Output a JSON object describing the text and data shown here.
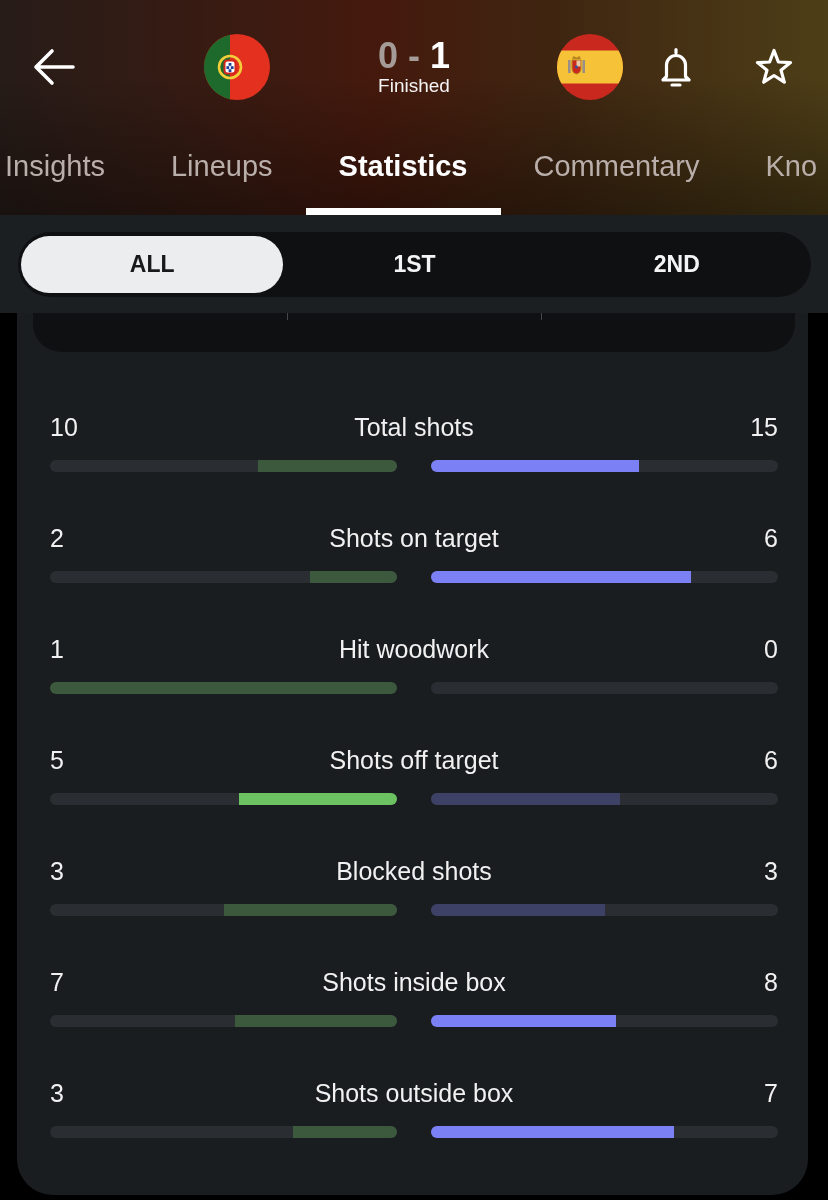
{
  "match": {
    "score": {
      "home": {
        "text": "0",
        "dimmed": true
      },
      "separator": "-",
      "away": {
        "text": "1",
        "dimmed": false
      }
    },
    "status": "Finished"
  },
  "tabs": [
    {
      "label": "Insights",
      "selected": false
    },
    {
      "label": "Lineups",
      "selected": false
    },
    {
      "label": "Statistics",
      "selected": true
    },
    {
      "label": "Commentary",
      "selected": false
    },
    {
      "label": "Kno",
      "selected": false
    }
  ],
  "periods": [
    {
      "label": "ALL",
      "selected": true
    },
    {
      "label": "1ST",
      "selected": false
    },
    {
      "label": "2ND",
      "selected": false
    }
  ],
  "stats": [
    {
      "label": "Total shots",
      "home": {
        "value": "10",
        "level": 0.4,
        "highlighted": false
      },
      "away": {
        "value": "15",
        "level": 0.6,
        "highlighted": true
      }
    },
    {
      "label": "Shots on target",
      "home": {
        "value": "2",
        "level": 0.25,
        "highlighted": false
      },
      "away": {
        "value": "6",
        "level": 0.75,
        "highlighted": true
      }
    },
    {
      "label": "Hit woodwork",
      "home": {
        "value": "1",
        "level": 1,
        "highlighted": false
      },
      "away": {
        "value": "0"
      }
    },
    {
      "label": "Shots off target",
      "home": {
        "value": "5",
        "level": 0.455,
        "highlighted": true
      },
      "away": {
        "value": "6",
        "level": 0.545,
        "highlighted": false
      }
    },
    {
      "label": "Blocked shots",
      "home": {
        "value": "3",
        "level": 0.5,
        "highlighted": false
      },
      "away": {
        "value": "3",
        "level": 0.5,
        "highlighted": false
      }
    },
    {
      "label": "Shots inside box",
      "home": {
        "value": "7",
        "level": 0.467,
        "highlighted": false
      },
      "away": {
        "value": "8",
        "level": 0.533,
        "highlighted": true
      }
    },
    {
      "label": "Shots outside box",
      "home": {
        "value": "3",
        "level": 0.3,
        "highlighted": false
      },
      "away": {
        "value": "7",
        "level": 0.7,
        "highlighted": true
      }
    }
  ]
}
